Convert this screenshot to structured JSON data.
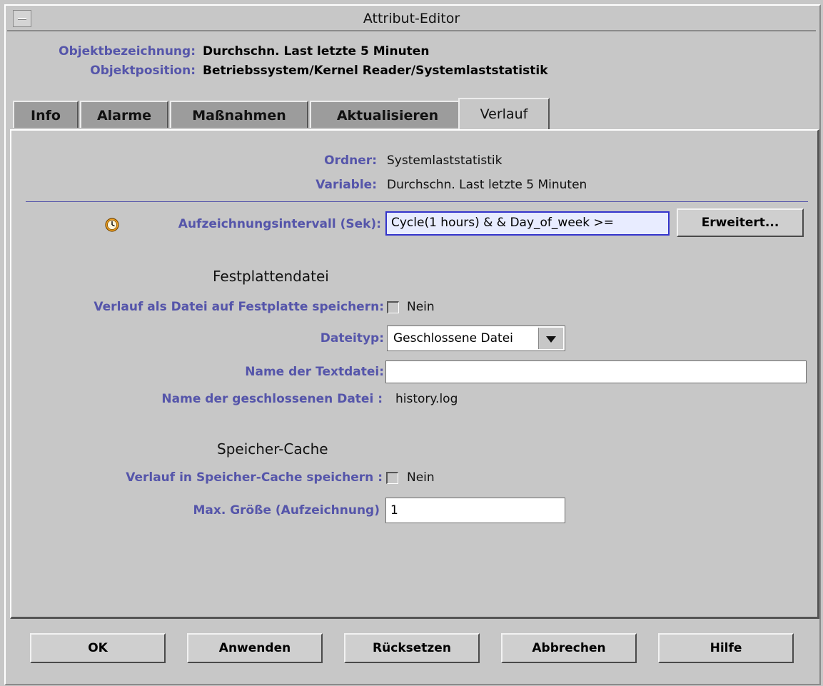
{
  "window": {
    "title": "Attribut-Editor"
  },
  "header": {
    "name_label": "Objektbezeichnung:",
    "name_value": "Durchschn. Last letzte 5 Minuten",
    "position_label": "Objektposition:",
    "position_value": "Betriebssystem/Kernel Reader/Systemlaststatistik"
  },
  "tabs": [
    {
      "label": "Info"
    },
    {
      "label": "Alarme"
    },
    {
      "label": "Maßnahmen"
    },
    {
      "label": "Aktualisieren"
    },
    {
      "label": "Verlauf",
      "active": true
    }
  ],
  "panel": {
    "folder_label": "Ordner:",
    "folder_value": "Systemlaststatistik",
    "variable_label": "Variable:",
    "variable_value": "Durchschn. Last letzte 5 Minuten",
    "interval_label": "Aufzeichnungsintervall (Sek):",
    "interval_value": "Cycle(1 hours) & & Day_of_week >=",
    "advanced_button": "Erweitert...",
    "disk_section": "Festplattendatei",
    "save_disk_label": "Verlauf als Datei auf Festplatte speichern:",
    "save_disk_value": "Nein",
    "filetype_label": "Dateityp:",
    "filetype_value": "Geschlossene Datei",
    "textfile_label": "Name der Textdatei:",
    "textfile_value": "",
    "closedfile_label": "Name der geschlossenen Datei :",
    "closedfile_value": "history.log",
    "cache_section": "Speicher-Cache",
    "save_cache_label": "Verlauf in Speicher-Cache speichern :",
    "save_cache_value": "Nein",
    "maxsize_label": "Max. Größe (Aufzeichnung)",
    "maxsize_value": "1"
  },
  "buttons": {
    "ok": "OK",
    "apply": "Anwenden",
    "reset": "Rücksetzen",
    "cancel": "Abbrechen",
    "help": "Hilfe"
  },
  "icons": {
    "window_menu": "window-menu-icon",
    "interval": "clock-icon",
    "dropdown": "chevron-down-icon"
  }
}
